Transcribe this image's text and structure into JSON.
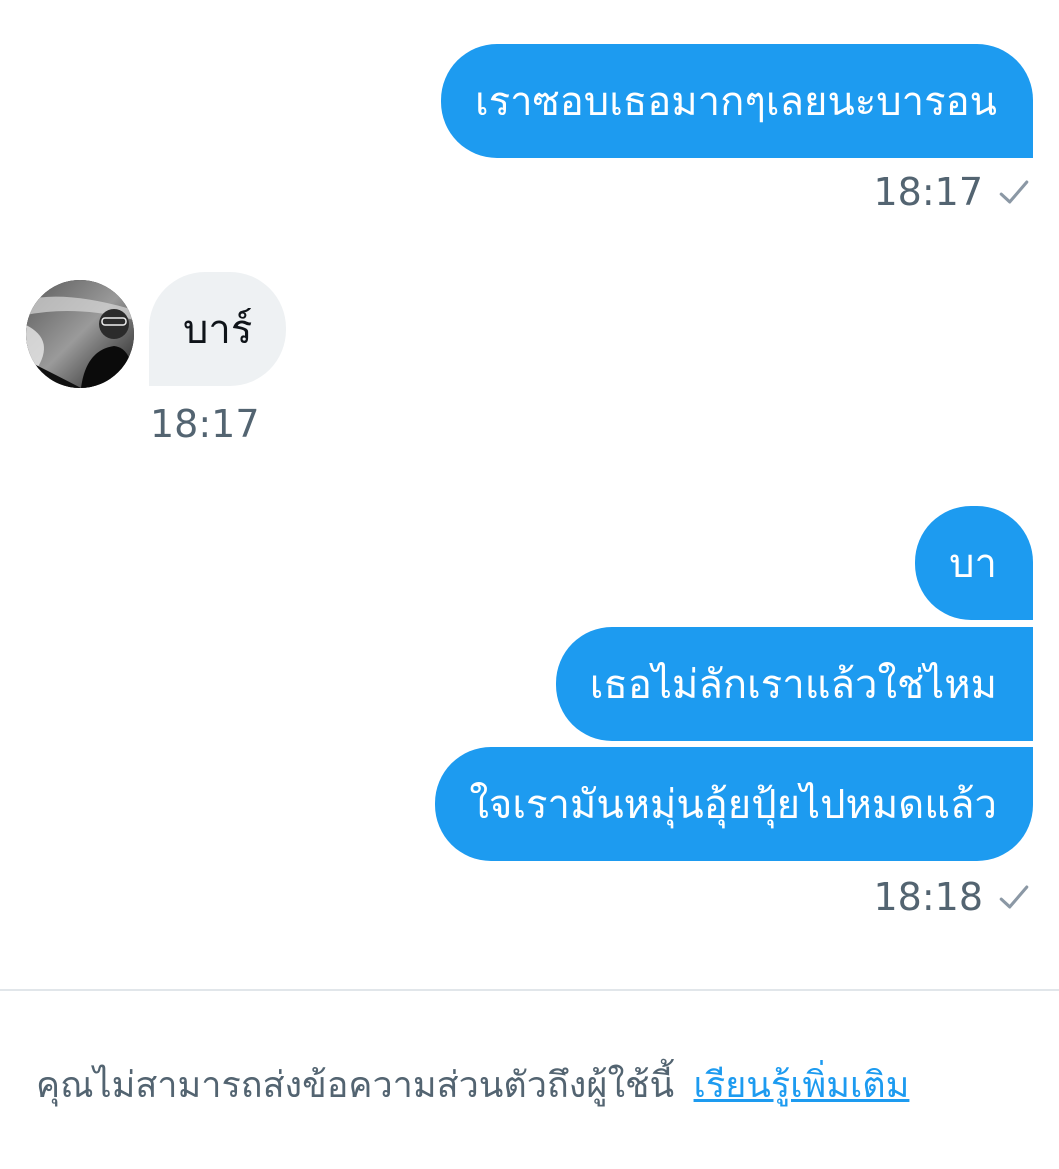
{
  "messages": [
    {
      "text": "เราซอบเธอมากๆเลยนะบารอน"
    },
    {
      "text": "บาร์"
    },
    {
      "text": "บา"
    },
    {
      "text": "เธอไม่ลักเราแล้วใช่ไหม"
    },
    {
      "text": "ใจเรามันหมุ่นอุ้ยปุ้ยไปหมดแล้ว"
    }
  ],
  "timestamps": {
    "first_out": "18:17",
    "incoming": "18:17",
    "last_out": "18:18"
  },
  "footer": {
    "notice": "คุณไม่สามารถส่งข้อความส่วนตัวถึงผู้ใช้นี้",
    "link": "เรียนรู้เพิ่มเติม"
  },
  "colors": {
    "outgoing_bubble": "#1d9bf0",
    "incoming_bubble": "#eef1f3",
    "meta_text": "#536471",
    "link": "#1d9bf0"
  },
  "icons": {
    "sent_status": "check-icon"
  }
}
